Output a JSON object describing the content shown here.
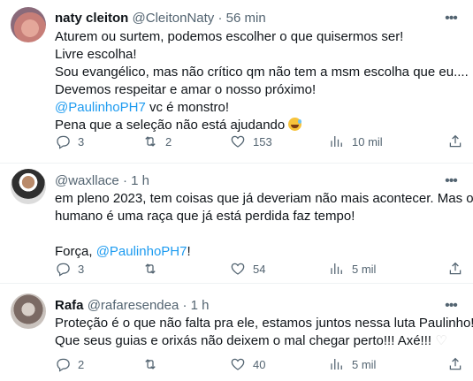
{
  "tweets": [
    {
      "name": "naty cleiton",
      "handle": "@CleitonNaty",
      "dot": "·",
      "time": "56 min",
      "lines": [
        "Aturem ou surtem, podemos escolher o que quisermos ser!",
        "Livre escolha!",
        "Sou evangélico, mas não crítico qm não tem a msm escolha que eu....",
        "Devemos respeitar e amar o nosso próximo!"
      ],
      "mention_line": {
        "mention": "@PaulinhoPH7",
        "rest": " vc é monstro!"
      },
      "last_line": "Pena que a seleção não está ajudando ",
      "emoji": "sweat-smile-emoji",
      "replies": "3",
      "retweets": "2",
      "likes": "153",
      "views": "10 mil"
    },
    {
      "name": "",
      "handle": "@waxllace",
      "dot": "·",
      "time": "1 h",
      "lines": [
        "em pleno 2023, tem coisas que já deveriam não mais acontecer. Mas o ser",
        "humano é uma raça que já está perdida faz tempo!"
      ],
      "forca_prefix": "Força, ",
      "forca_mention": "@PaulinhoPH7",
      "forca_suffix": "!",
      "replies": "3",
      "retweets": "",
      "likes": "54",
      "views": "5 mil"
    },
    {
      "name": "Rafa",
      "handle": "@rafaresendea",
      "dot": "·",
      "time": "1 h",
      "lines": [
        "Proteção é o que não falta pra ele, estamos juntos nessa luta Paulinho!!!!!",
        "Que seus guias e orixás não deixem o mal chegar perto!!! Axé!!! "
      ],
      "heart": "♡",
      "replies": "2",
      "retweets": "",
      "likes": "40",
      "views": "5 mil"
    }
  ],
  "icons": {
    "reply": "reply-icon",
    "retweet": "retweet-icon",
    "like": "heart-icon",
    "views": "views-icon",
    "share": "share-icon",
    "more": "more-icon"
  },
  "colors": {
    "link": "#1d9bf0",
    "secondary": "#536471",
    "text": "#0f1419",
    "divider": "#eff3f4"
  }
}
